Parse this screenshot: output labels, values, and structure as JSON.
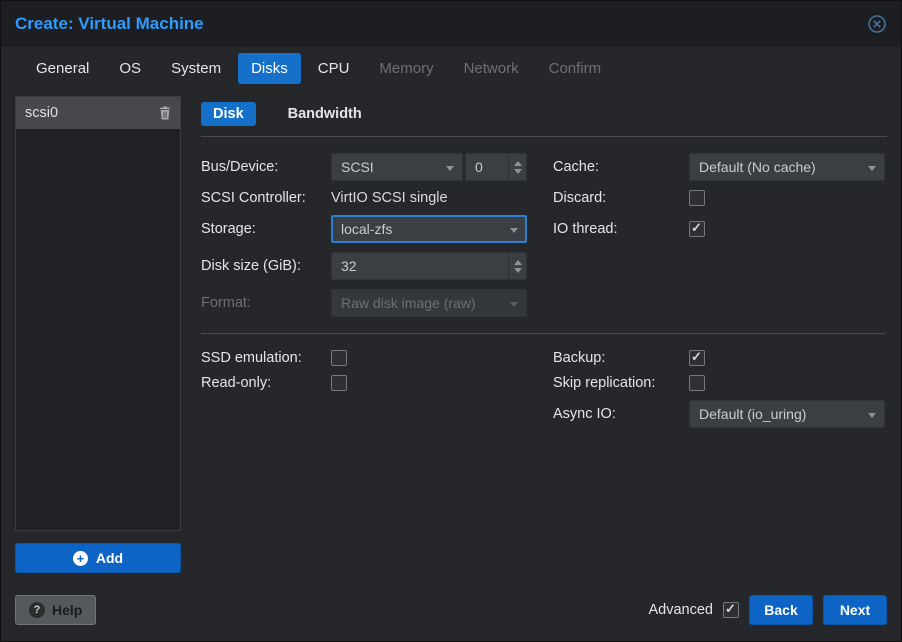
{
  "colors": {
    "accent": "#1470c8",
    "title": "#2e9bfd",
    "dialog-bg": "#26272b",
    "titlebar-bg": "#1d1e22",
    "panel-bg": "#202125",
    "input-bg": "#3b3e43",
    "text": "#e3e5e8",
    "muted": "#6c7074"
  },
  "window": {
    "title": "Create: Virtual Machine"
  },
  "tabs": [
    {
      "label": "General",
      "state": "normal"
    },
    {
      "label": "OS",
      "state": "normal"
    },
    {
      "label": "System",
      "state": "normal"
    },
    {
      "label": "Disks",
      "state": "active"
    },
    {
      "label": "CPU",
      "state": "normal"
    },
    {
      "label": "Memory",
      "state": "disabled"
    },
    {
      "label": "Network",
      "state": "disabled"
    },
    {
      "label": "Confirm",
      "state": "disabled"
    }
  ],
  "disk_list": {
    "items": [
      {
        "label": "scsi0",
        "selected": true
      }
    ],
    "add_label": "Add"
  },
  "subtabs": [
    {
      "label": "Disk",
      "state": "active"
    },
    {
      "label": "Bandwidth",
      "state": "normal"
    }
  ],
  "form": {
    "bus_device": {
      "label": "Bus/Device:",
      "bus_value": "SCSI",
      "device_value": "0"
    },
    "cache": {
      "label": "Cache:",
      "value": "Default (No cache)"
    },
    "scsi_controller": {
      "label": "SCSI Controller:",
      "value": "VirtIO SCSI single"
    },
    "discard": {
      "label": "Discard:",
      "checked": false
    },
    "storage": {
      "label": "Storage:",
      "value": "local-zfs",
      "state": "focused"
    },
    "io_thread": {
      "label": "IO thread:",
      "checked": true
    },
    "disk_size": {
      "label": "Disk size (GiB):",
      "value": "32"
    },
    "format": {
      "label": "Format:",
      "value": "Raw disk image (raw)",
      "state": "disabled"
    },
    "ssd_emulation": {
      "label": "SSD emulation:",
      "checked": false
    },
    "backup": {
      "label": "Backup:",
      "checked": true
    },
    "read_only": {
      "label": "Read-only:",
      "checked": false
    },
    "skip_replication": {
      "label": "Skip replication:",
      "checked": false
    },
    "async_io": {
      "label": "Async IO:",
      "value": "Default (io_uring)"
    }
  },
  "footer": {
    "help_label": "Help",
    "advanced_label": "Advanced",
    "advanced_checked": true,
    "back_label": "Back",
    "next_label": "Next"
  }
}
